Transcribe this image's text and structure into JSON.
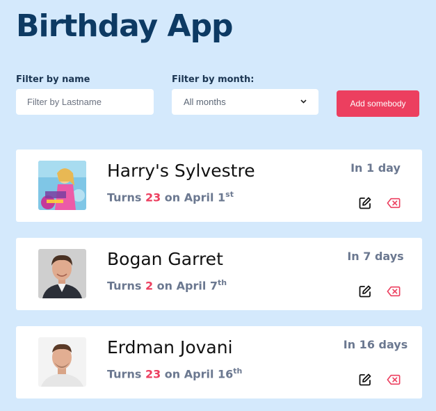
{
  "app": {
    "title": "Birthday App"
  },
  "filters": {
    "name_label": "Filter by name",
    "name_placeholder": "Filter by Lastname",
    "month_label": "Filter by month:",
    "month_selected": "All months",
    "add_button": "Add somebody"
  },
  "colors": {
    "background": "#d4e9fc",
    "title": "#0d3a63",
    "accent": "#ec3f5f",
    "muted": "#6b7890"
  },
  "people": [
    {
      "name": "Harry's Sylvestre",
      "turns_prefix": "Turns",
      "age": "23",
      "on_text": "on April 1",
      "ordinal": "st",
      "countdown": "In 1 day",
      "avatar": "hannah-montana-poster"
    },
    {
      "name": "Bogan Garret",
      "turns_prefix": "Turns",
      "age": "2",
      "on_text": "on April 7",
      "ordinal": "th",
      "countdown": "In 7 days",
      "avatar": "man-portrait-suit"
    },
    {
      "name": "Erdman Jovani",
      "turns_prefix": "Turns",
      "age": "23",
      "on_text": "on April 16",
      "ordinal": "th",
      "countdown": "In 16 days",
      "avatar": "man-portrait-white"
    }
  ]
}
